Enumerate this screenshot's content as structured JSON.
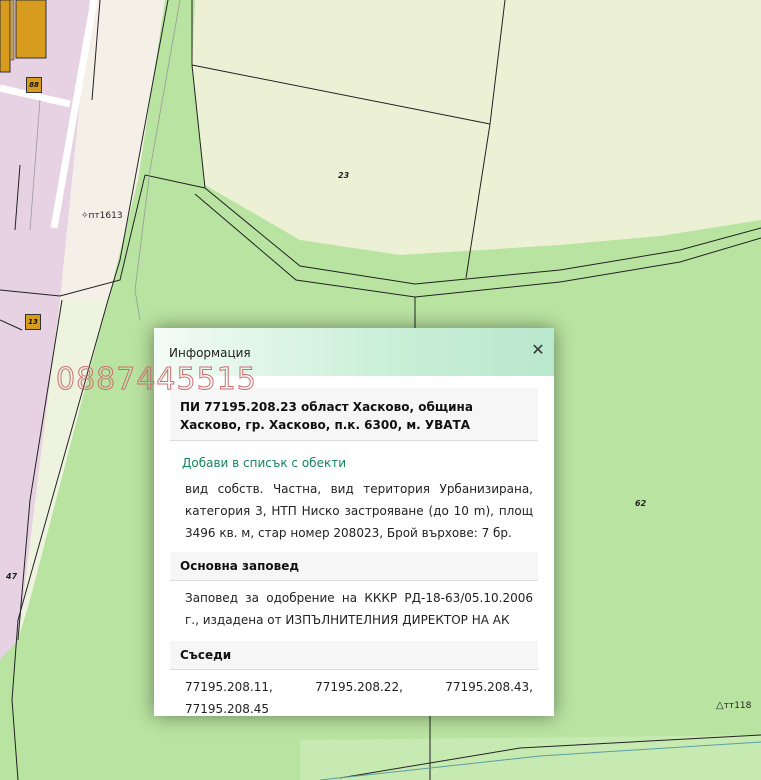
{
  "map": {
    "labels": {
      "parcel_23": "23",
      "parcel_62": "62",
      "parcel_47": "47",
      "building_88": "88",
      "building_13": "13",
      "point_pt1613": "пт1613",
      "point_tt118": "тт118"
    }
  },
  "watermark": "0887445515",
  "popup": {
    "title": "Информация",
    "close_icon": "close-icon",
    "parcel_heading": "ПИ 77195.208.23 област Хасково, община Хасково, гр. Хасково, п.к. 6300, м. УВАТА",
    "add_link": "Добави в списък с обекти",
    "description": "вид собств. Частна, вид територия Урбанизирана, категория 3, НТП Ниско застрояване (до 10 m), площ 3496 кв. м, стар номер 208023, Брой върхове: 7 бр.",
    "order_heading": "Основна заповед",
    "order_text": "Заповед за одобрение на КККР РД-18-63/05.10.2006 г., издадена от ИЗПЪЛНИТЕЛНИЯ ДИРЕКТОР НА АК",
    "neighbours_heading": "Съседи",
    "neighbours_text": "77195.208.11, 77195.208.22, 77195.208.43, 77195.208.45"
  },
  "colors": {
    "map_green": "#b9e3a0",
    "map_light": "#ecf0d5",
    "urban_pink": "#e8d4e4",
    "road_white": "#f5f1ea",
    "building_orange": "#d79b1d",
    "link_green": "#13845d"
  }
}
